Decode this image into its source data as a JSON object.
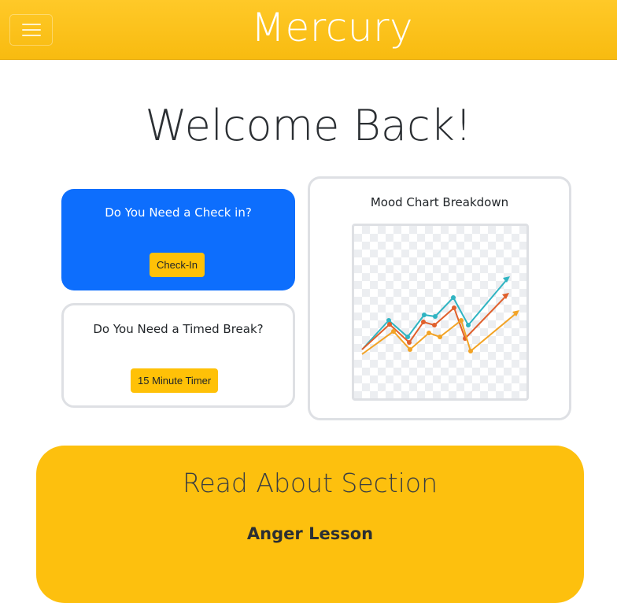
{
  "header": {
    "brand": "Mercury",
    "menu_icon": "hamburger-menu-icon",
    "color": "#ffc107"
  },
  "main": {
    "welcome": "Welcome Back!"
  },
  "checkin_card": {
    "title": "Do You Need a Check in?",
    "button_label": "Check-In",
    "color": "#0d6efd"
  },
  "timer_card": {
    "title": "Do You Need a Timed Break?",
    "button_label": "15 Minute Timer"
  },
  "mood_card": {
    "title": "Mood Chart Breakdown",
    "image_icon": "trend-lines-chart-illustration"
  },
  "read_section": {
    "title": "Read About Section",
    "items": [
      "Anger Lesson"
    ],
    "color": "#fdc00e"
  }
}
